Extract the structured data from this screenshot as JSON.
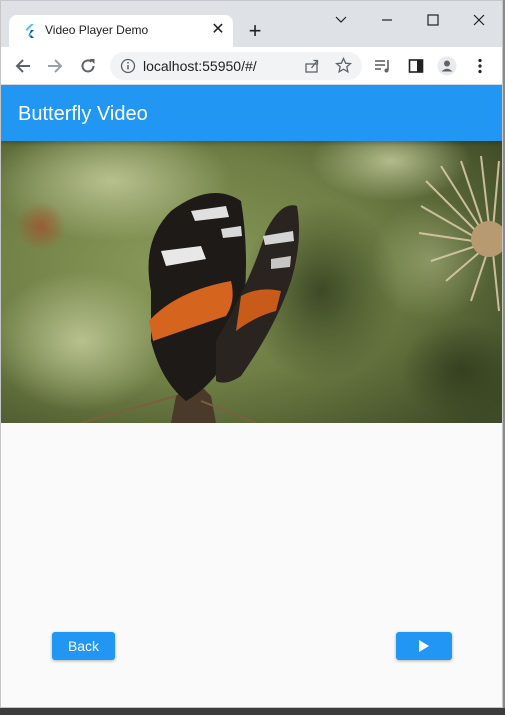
{
  "browser": {
    "tab_title": "Video Player Demo",
    "tab_close": "✕",
    "new_tab": "+",
    "url": "localhost:55950/#/",
    "window_controls": [
      "chevron-down-icon",
      "minimize-icon",
      "maximize-icon",
      "close-icon"
    ],
    "toolbar_icons": [
      "back-icon",
      "forward-icon",
      "reload-icon",
      "info-icon",
      "share-icon",
      "star-icon",
      "media-icon",
      "sidepanel-icon",
      "profile-icon",
      "menu-icon"
    ]
  },
  "app": {
    "title": "Butterfly Video",
    "primary_color": "#2196f3",
    "back_label": "Back",
    "play_icon": "play-icon"
  }
}
